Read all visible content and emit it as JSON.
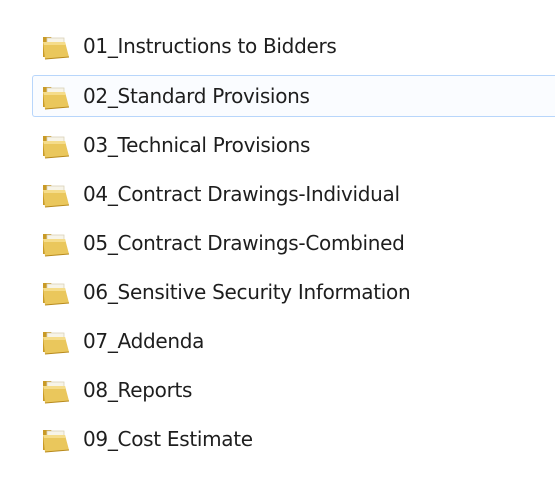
{
  "folders": [
    {
      "name": "01_Instructions to Bidders",
      "icon": "folder-icon",
      "selected": false
    },
    {
      "name": "02_Standard Provisions",
      "icon": "folder-icon",
      "selected": true
    },
    {
      "name": "03_Technical Provisions",
      "icon": "folder-icon",
      "selected": false
    },
    {
      "name": "04_Contract Drawings-Individual",
      "icon": "folder-icon",
      "selected": false
    },
    {
      "name": "05_Contract Drawings-Combined",
      "icon": "folder-icon",
      "selected": false
    },
    {
      "name": "06_Sensitive Security Information",
      "icon": "folder-icon",
      "selected": false
    },
    {
      "name": "07_Addenda",
      "icon": "folder-icon",
      "selected": false
    },
    {
      "name": "08_Reports",
      "icon": "folder-icon",
      "selected": false
    },
    {
      "name": "09_Cost Estimate",
      "icon": "folder-icon",
      "selected": false
    }
  ],
  "colors": {
    "folder_body": "#e8c65a",
    "folder_back": "#d4a832",
    "folder_paper": "#f7f4e8",
    "selection_border": "#b8d6fb",
    "text": "#1e1e1e"
  }
}
